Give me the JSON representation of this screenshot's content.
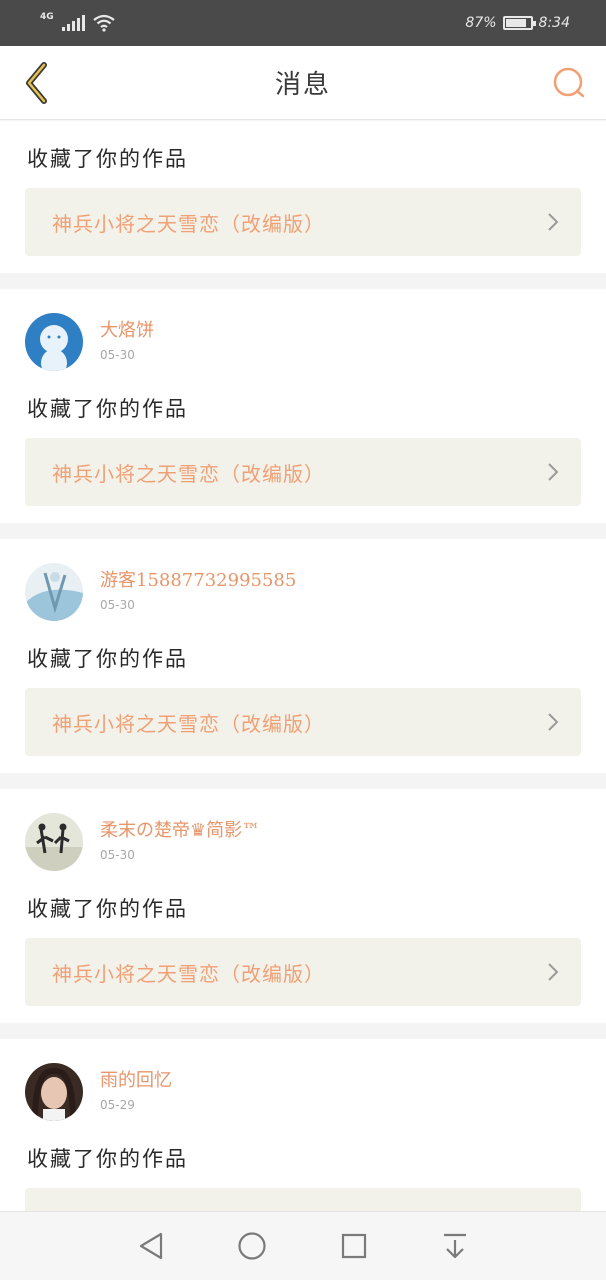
{
  "status_bar": {
    "network": "4G",
    "battery_percent": "87%",
    "battery_level": 0.87,
    "time": "8:34"
  },
  "header": {
    "title": "消息",
    "back_icon": "chevron-left-icon",
    "search_icon": "search-icon"
  },
  "accent_color": "#e8956a",
  "notifications": [
    {
      "username": "",
      "date": "",
      "action": "收藏了你的作品",
      "work_title": "神兵小将之天雪恋（改编版）",
      "avatar_colors": [
        "#ffffff",
        "#ffffff"
      ]
    },
    {
      "username": "大烙饼",
      "date": "05-30",
      "action": "收藏了你的作品",
      "work_title": "神兵小将之天雪恋（改编版）",
      "avatar_colors": [
        "#2f7fc4",
        "#dfeef8"
      ]
    },
    {
      "username": "游客15887732995585",
      "date": "05-30",
      "action": "收藏了你的作品",
      "work_title": "神兵小将之天雪恋（改编版）",
      "avatar_colors": [
        "#9cc4da",
        "#eef3f6"
      ]
    },
    {
      "username": "柔末の楚帝♛简影™",
      "date": "05-30",
      "action": "收藏了你的作品",
      "work_title": "神兵小将之天雪恋（改编版）",
      "avatar_colors": [
        "#d9dccd",
        "#2b2b2b"
      ]
    },
    {
      "username": "雨的回忆",
      "date": "05-29",
      "action": "收藏了你的作品",
      "work_title": "",
      "avatar_colors": [
        "#3a2a24",
        "#e7c7b4"
      ]
    }
  ],
  "nav": {
    "back_icon": "triangle-back-icon",
    "home_icon": "circle-home-icon",
    "recents_icon": "square-recents-icon",
    "notification_icon": "pull-down-icon"
  }
}
